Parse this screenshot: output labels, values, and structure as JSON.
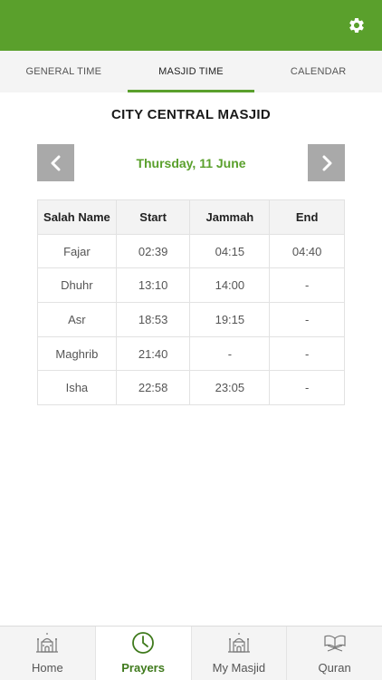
{
  "tabs": [
    {
      "label": "GENERAL TIME",
      "active": false
    },
    {
      "label": "MASJID TIME",
      "active": true
    },
    {
      "label": "CALENDAR",
      "active": false
    }
  ],
  "masjid_name": "CITY CENTRAL MASJID",
  "date_label": "Thursday, 11 June",
  "table": {
    "headers": [
      "Salah Name",
      "Start",
      "Jammah",
      "End"
    ],
    "rows": [
      [
        "Fajar",
        "02:39",
        "04:15",
        "04:40"
      ],
      [
        "Dhuhr",
        "13:10",
        "14:00",
        "-"
      ],
      [
        "Asr",
        "18:53",
        "19:15",
        "-"
      ],
      [
        "Maghrib",
        "21:40",
        "-",
        "-"
      ],
      [
        "Isha",
        "22:58",
        "23:05",
        "-"
      ]
    ]
  },
  "bottom_nav": [
    {
      "label": "Home",
      "icon": "mosque-icon",
      "active": false
    },
    {
      "label": "Prayers",
      "icon": "clock-icon",
      "active": true
    },
    {
      "label": "My Masjid",
      "icon": "mosque-icon",
      "active": false
    },
    {
      "label": "Quran",
      "icon": "quran-icon",
      "active": false
    }
  ],
  "colors": {
    "brand_green": "#5aa02c",
    "nav_button_gray": "#a9a9a9",
    "active_nav_text": "#3f7a1c"
  }
}
